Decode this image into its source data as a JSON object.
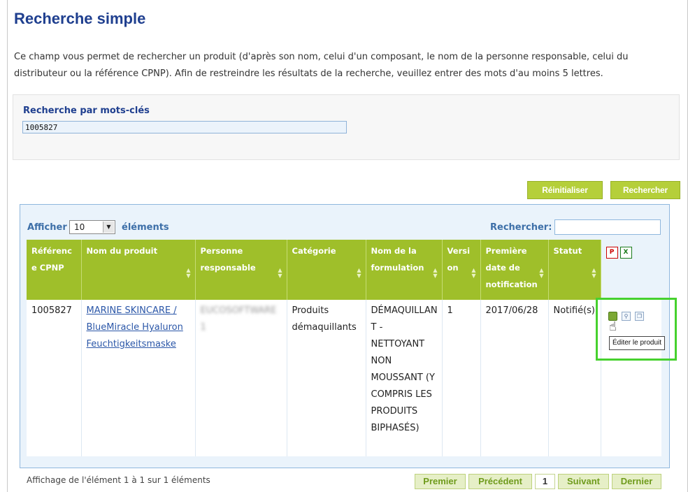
{
  "page": {
    "title": "Recherche simple",
    "intro": "Ce champ vous permet de rechercher un produit (d'après son nom, celui d'un composant, le nom de la personne responsable, celui du distributeur ou la référence CPNP). Afin de restreindre les résultats de la recherche, veuillez entrer des mots d'au moins 5 lettres."
  },
  "keyword_search": {
    "label": "Recherche par mots-clés",
    "value": "1005827"
  },
  "buttons": {
    "reset": "Réinitialiser",
    "search": "Rechercher"
  },
  "results": {
    "show_label": "Afficher",
    "page_size": "10",
    "show_suffix": "éléments",
    "filter_label": "Rechercher:",
    "filter_value": "",
    "columns": [
      "Référenc e CPNP",
      "Nom du produit",
      "Personne responsable",
      "Catégorie",
      "Nom de la formulation",
      "Versi on",
      "Première date de notification",
      "Statut"
    ],
    "export_icons": [
      "pdf-icon",
      "excel-icon"
    ],
    "rows": [
      {
        "ref": "1005827",
        "product_name": "MARINE SKINCARE / BlueMiracle Hyaluron Feuchtigkeitsmaske",
        "responsible": "EUCOSOFTWARE 1",
        "category": "Produits démaquillants",
        "formulation": "DÉMAQUILLAN T - NETTOYANT NON MOUSSANT (Y COMPRIS LES PRODUITS BIPHASÉS)",
        "version": "1",
        "first_notification": "2017/06/28",
        "status": "Notifié(s)"
      }
    ],
    "row_actions": [
      "edit-icon",
      "view-icon",
      "copy-icon"
    ],
    "tooltip": "Éditer le produit",
    "info": "Affichage de l'élément 1 à 1 sur 1 éléments"
  },
  "pagination": {
    "first": "Premier",
    "prev": "Précédent",
    "current": "1",
    "next": "Suivant",
    "last": "Dernier"
  },
  "colors": {
    "title": "#1f3f8f",
    "header_green": "#9fbf2a",
    "button_green": "#b5cf3a",
    "highlight": "#46d12e",
    "link": "#2b57a8"
  }
}
